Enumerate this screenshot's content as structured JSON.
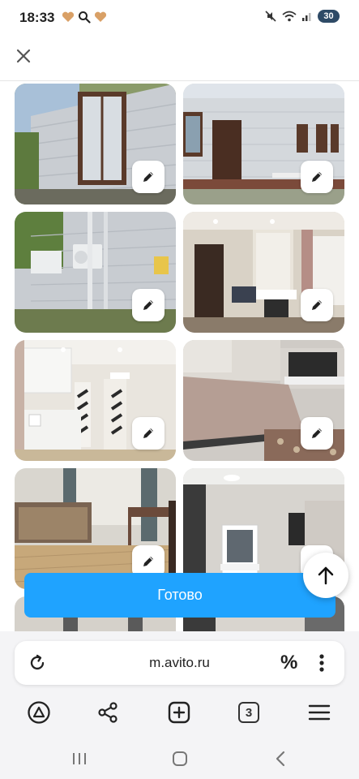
{
  "status_bar": {
    "time": "18:33",
    "battery": "30",
    "icons": [
      "heart-icon",
      "search-icon",
      "heart-icon",
      "mute-icon",
      "wifi-icon",
      "signal-icon"
    ]
  },
  "header": {
    "close_icon": "close-icon"
  },
  "gallery": {
    "photos": [
      {
        "subject": "house-exterior-window",
        "edit_icon": "pencil-icon"
      },
      {
        "subject": "house-exterior-door",
        "edit_icon": "pencil-icon"
      },
      {
        "subject": "house-wall-ac-units",
        "edit_icon": "pencil-icon"
      },
      {
        "subject": "living-room-dining",
        "edit_icon": "pencil-icon"
      },
      {
        "subject": "kitchen-hallway",
        "edit_icon": "pencil-icon"
      },
      {
        "subject": "bedroom-bed",
        "edit_icon": "pencil-icon"
      },
      {
        "subject": "room-sofa",
        "edit_icon": "pencil-icon"
      },
      {
        "subject": "room-mirror-tv",
        "edit_icon": "pencil-icon"
      }
    ]
  },
  "actions": {
    "done_label": "Готово",
    "scroll_up_icon": "arrow-up-icon"
  },
  "browser": {
    "url": "m.avito.ru",
    "percent_label": "%",
    "tab_count": "3"
  },
  "colors": {
    "accent": "#1fa3ff",
    "text": "#222222",
    "toolbar_bg": "#f4f4f6"
  }
}
